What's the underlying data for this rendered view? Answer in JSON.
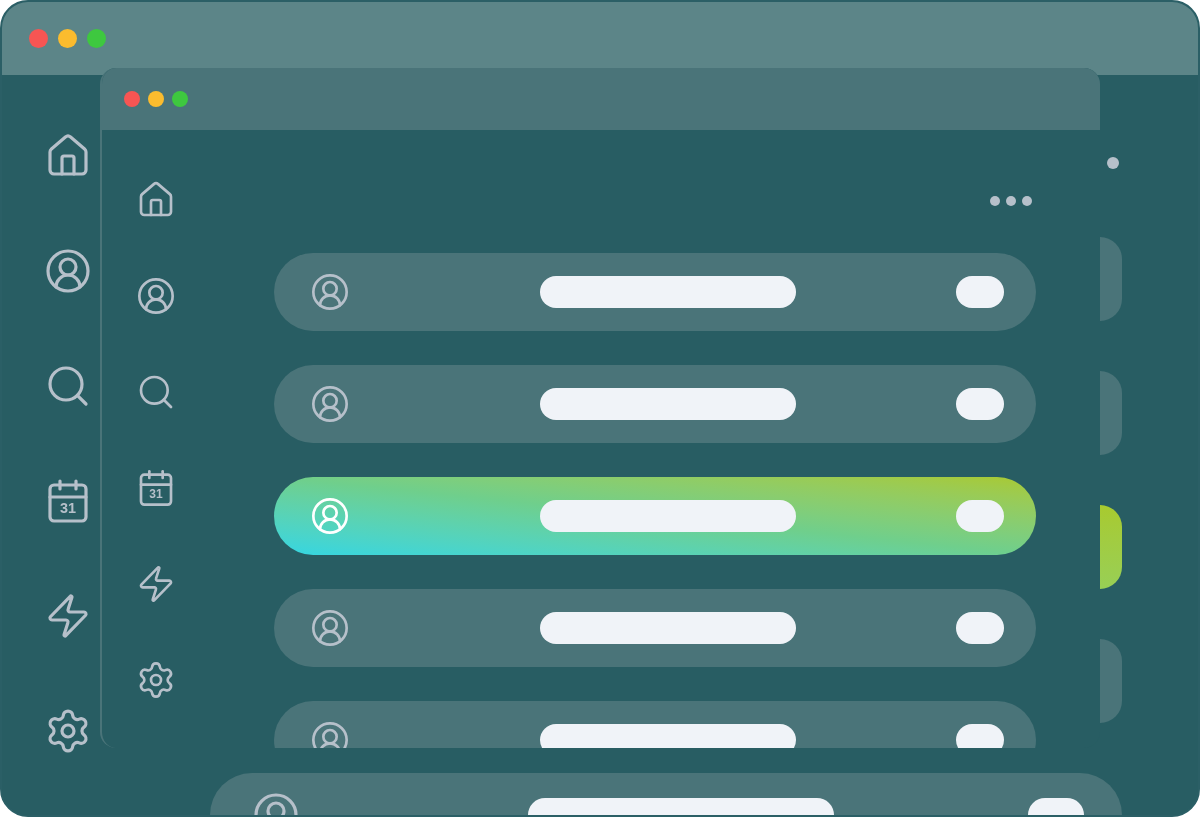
{
  "windows": [
    {
      "sidebar": [
        {
          "kind": "home"
        },
        {
          "kind": "profile"
        },
        {
          "kind": "search"
        },
        {
          "kind": "calendar",
          "day": "31"
        },
        {
          "kind": "bolt"
        },
        {
          "kind": "settings"
        }
      ],
      "rows": [
        {
          "selected": false
        },
        {
          "selected": false
        },
        {
          "selected": true
        },
        {
          "selected": false
        },
        {
          "selected": false
        }
      ]
    },
    {
      "sidebar": [
        {
          "kind": "home"
        },
        {
          "kind": "profile"
        },
        {
          "kind": "search"
        },
        {
          "kind": "calendar",
          "day": "31"
        },
        {
          "kind": "bolt"
        },
        {
          "kind": "settings"
        }
      ],
      "rows": [
        {
          "selected": false
        },
        {
          "selected": false
        },
        {
          "selected": true
        },
        {
          "selected": false
        },
        {
          "selected": false
        }
      ]
    }
  ]
}
